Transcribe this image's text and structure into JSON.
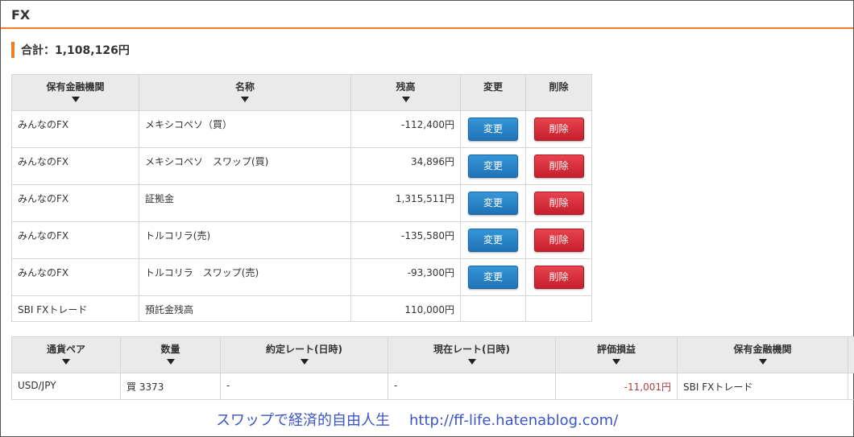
{
  "section_title": "FX",
  "total_label": "合計：1,108,126円",
  "asset_table": {
    "headers": [
      "保有金融機関",
      "名称",
      "残高",
      "変更",
      "削除"
    ],
    "rows": [
      {
        "institution": "みんなのFX",
        "name": "メキシコペソ（買）",
        "balance": "-112,400円",
        "edit": "変更",
        "delete": "削除"
      },
      {
        "institution": "みんなのFX",
        "name": "メキシコペソ　スワップ(買)",
        "balance": "34,896円",
        "edit": "変更",
        "delete": "削除"
      },
      {
        "institution": "みんなのFX",
        "name": "証拠金",
        "balance": "1,315,511円",
        "edit": "変更",
        "delete": "削除"
      },
      {
        "institution": "みんなのFX",
        "name": "トルコリラ(売)",
        "balance": "-135,580円",
        "edit": "変更",
        "delete": "削除"
      },
      {
        "institution": "みんなのFX",
        "name": "トルコリラ　スワップ(売)",
        "balance": "-93,300円",
        "edit": "変更",
        "delete": "削除"
      },
      {
        "institution": "SBI FXトレード",
        "name": "預託金残高",
        "balance": "110,000円"
      }
    ]
  },
  "position_table": {
    "headers": [
      "通貨ペア",
      "数量",
      "約定レート(日時)",
      "現在レート(日時)",
      "評価損益",
      "保有金融機関"
    ],
    "rows": [
      {
        "pair": "USD/JPY",
        "quantity": "買 3373",
        "contract_rate": "-",
        "current_rate": "-",
        "pnl": "-11,001円",
        "institution": "SBI FXトレード"
      }
    ]
  },
  "colors": {
    "accent": "#ee7d2b",
    "edit_button": "#2a82c8",
    "delete_button": "#d9303d",
    "loss_text": "#b04040",
    "footer_text": "#3a55c8"
  },
  "footer": {
    "blog_name": "スワップで経済的自由人生",
    "url": "http://ff-life.hatenablog.com/"
  }
}
